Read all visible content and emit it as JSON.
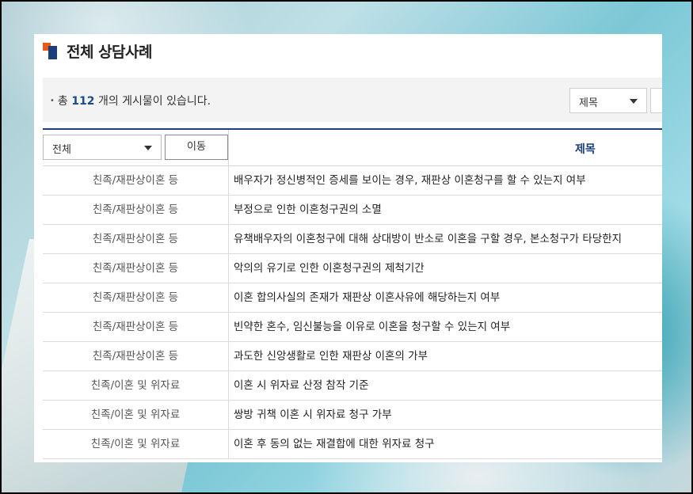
{
  "page": {
    "title": "전체 상담사례"
  },
  "info_bar": {
    "bullet": "•",
    "count_prefix": "총",
    "count": "112",
    "count_suffix": "개의 게시물이 있습니다.",
    "search_field": {
      "selected": "제목"
    },
    "search_input": {
      "value": ""
    }
  },
  "table": {
    "category_filter": {
      "selected": "전체"
    },
    "move_button": "이동",
    "column_title": "제목",
    "rows": [
      {
        "category": "친족/재판상이혼 등",
        "subject": "배우자가 정신병적인 증세를 보이는 경우, 재판상 이혼청구를 할 수 있는지 여부"
      },
      {
        "category": "친족/재판상이혼 등",
        "subject": "부정으로 인한 이혼청구권의 소멸"
      },
      {
        "category": "친족/재판상이혼 등",
        "subject": "유책배우자의 이혼청구에 대해 상대방이 반소로 이혼을 구할 경우, 본소청구가 타당한지"
      },
      {
        "category": "친족/재판상이혼 등",
        "subject": "악의의 유기로 인한 이혼청구권의 제척기간"
      },
      {
        "category": "친족/재판상이혼 등",
        "subject": "이혼 합의사실의 존재가 재판상 이혼사유에 해당하는지 여부"
      },
      {
        "category": "친족/재판상이혼 등",
        "subject": "빈약한 혼수, 임신불능을 이유로 이혼을 청구할 수 있는지 여부"
      },
      {
        "category": "친족/재판상이혼 등",
        "subject": "과도한 신앙생활로 인한 재판상 이혼의 가부"
      },
      {
        "category": "친족/이혼 및 위자료",
        "subject": "이혼 시 위자료 산정 참작 기준"
      },
      {
        "category": "친족/이혼 및 위자료",
        "subject": "쌍방 귀책 이혼 시 위자료 청구 가부"
      },
      {
        "category": "친족/이혼 및 위자료",
        "subject": "이혼 후 동의 없는 재결합에 대한 위자료 청구"
      }
    ]
  },
  "colors": {
    "accent_navy": "#1a3f7a",
    "accent_orange": "#e85c1b",
    "count_blue": "#1a4c8c"
  }
}
